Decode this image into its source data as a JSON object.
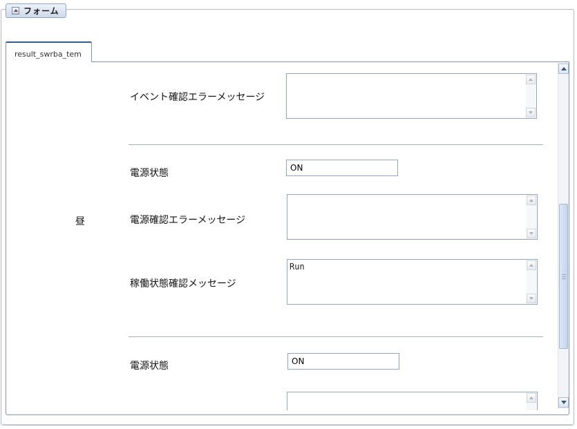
{
  "form_header": {
    "title": "フォーム",
    "icon": "collapse-icon"
  },
  "tabs": [
    {
      "label": "result_swrba_tem"
    }
  ],
  "content": {
    "group_label": "昼",
    "fields": {
      "event_error_label": "イベント確認エラーメッセージ",
      "event_error_value": "",
      "power1_label": "電源状態",
      "power1_value": "ON",
      "power1_error_label": "電源確認エラーメッセージ",
      "power1_error_value": "",
      "operation_label": "稼働状態確認メッセージ",
      "operation_value": "Run",
      "power2_label": "電源状態",
      "power2_value": "ON",
      "power2_error_value": ""
    }
  },
  "colors": {
    "accent": "#375a8c",
    "border": "#8fa4bf"
  }
}
